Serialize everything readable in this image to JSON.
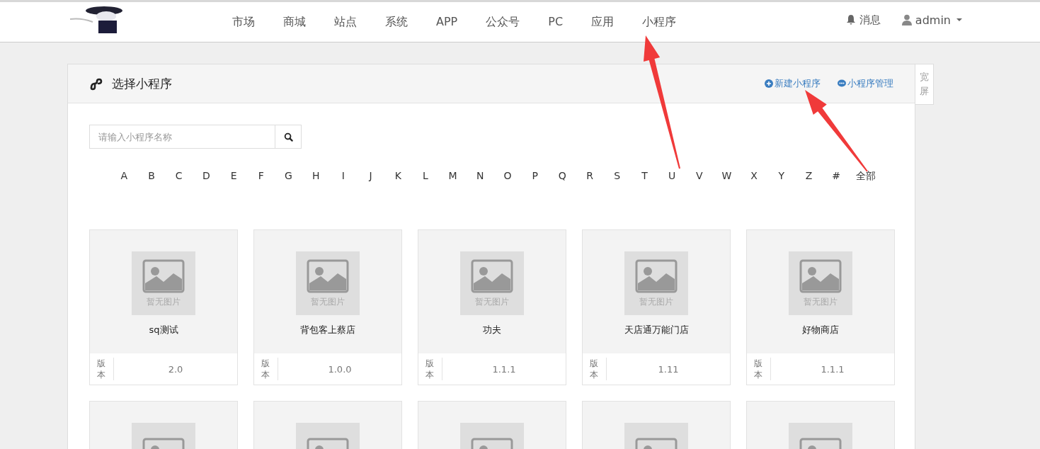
{
  "nav": {
    "items": [
      "市场",
      "商城",
      "站点",
      "系统",
      "APP",
      "公众号",
      "PC",
      "应用",
      "小程序"
    ],
    "messages": "消息",
    "user": "admin"
  },
  "panel": {
    "title": "选择小程序",
    "actions": [
      {
        "kind": "create",
        "label": "新建小程序"
      },
      {
        "kind": "manage",
        "label": "小程序管理"
      }
    ],
    "side_tab": "宽屏"
  },
  "search": {
    "placeholder": "请输入小程序名称"
  },
  "letters": [
    "A",
    "B",
    "C",
    "D",
    "E",
    "F",
    "G",
    "H",
    "I",
    "J",
    "K",
    "L",
    "M",
    "N",
    "O",
    "P",
    "Q",
    "R",
    "S",
    "T",
    "U",
    "V",
    "W",
    "X",
    "Y",
    "Z",
    "#",
    "全部"
  ],
  "cards": [
    {
      "kind": "full",
      "image_label": "暂无图片",
      "name": "sq测试",
      "version_label": "版本",
      "version": "2.0"
    },
    {
      "kind": "full",
      "image_label": "暂无图片",
      "name": "背包客上蔡店",
      "version_label": "版本",
      "version": "1.0.0"
    },
    {
      "kind": "full",
      "image_label": "暂无图片",
      "name": "功夫",
      "version_label": "版本",
      "version": "1.1.1"
    },
    {
      "kind": "full",
      "image_label": "暂无图片",
      "name": "天店通万能门店",
      "version_label": "版本",
      "version": "1.11"
    },
    {
      "kind": "full",
      "image_label": "暂无图片",
      "name": "好物商店",
      "version_label": "版本",
      "version": "1.1.1"
    },
    {
      "kind": "partial"
    },
    {
      "kind": "partial"
    },
    {
      "kind": "partial"
    },
    {
      "kind": "partial"
    },
    {
      "kind": "partial"
    }
  ]
}
